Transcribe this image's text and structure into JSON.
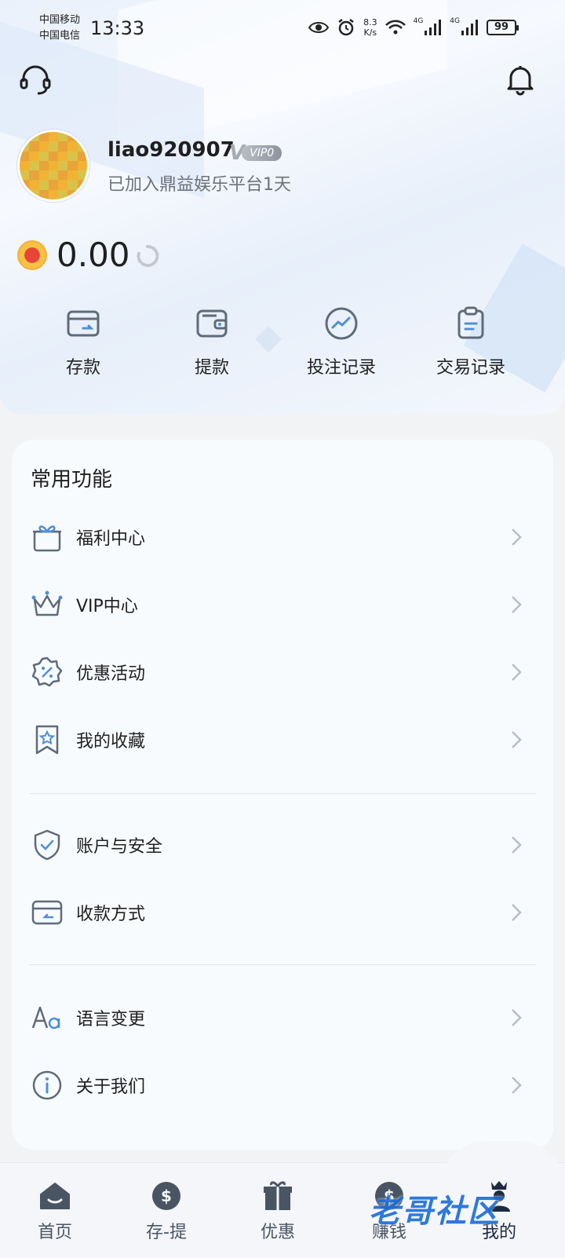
{
  "status_bar": {
    "carrier1": "中国移动",
    "carrier2": "中国电信",
    "time": "13:33",
    "net_speed_value": "8.3",
    "net_speed_unit": "K/s",
    "battery": "99",
    "net1": "4G",
    "net2": "4G"
  },
  "header": {
    "support_icon": "headset-icon",
    "bell_icon": "bell-icon"
  },
  "profile": {
    "username": "liao920907",
    "vip_v": "V",
    "vip_level": "VIP0",
    "joined_text": "已加入鼎益娱乐平台1天",
    "balance": "0.00"
  },
  "quick_actions": [
    {
      "label": "存款",
      "icon": "deposit-card-icon"
    },
    {
      "label": "提款",
      "icon": "wallet-icon"
    },
    {
      "label": "投注记录",
      "icon": "trend-icon"
    },
    {
      "label": "交易记录",
      "icon": "clipboard-icon"
    }
  ],
  "common_functions": {
    "title": "常用功能",
    "items": [
      {
        "label": "福利中心",
        "icon": "gift-icon"
      },
      {
        "label": "VIP中心",
        "icon": "crown-icon"
      },
      {
        "label": "优惠活动",
        "icon": "discount-badge-icon"
      },
      {
        "label": "我的收藏",
        "icon": "bookmark-star-icon"
      },
      {
        "label": "账户与安全",
        "icon": "shield-check-icon"
      },
      {
        "label": "收款方式",
        "icon": "card-icon"
      },
      {
        "label": "语言变更",
        "icon": "font-size-icon"
      },
      {
        "label": "关于我们",
        "icon": "info-icon"
      }
    ]
  },
  "bottom_nav": [
    {
      "label": "首页",
      "icon": "home-icon"
    },
    {
      "label": "存-提",
      "icon": "exchange-icon"
    },
    {
      "label": "优惠",
      "icon": "gift-box-icon"
    },
    {
      "label": "赚钱",
      "icon": "money-icon"
    },
    {
      "label": "我的",
      "icon": "profile-crown-icon"
    }
  ],
  "watermark": "老哥社区",
  "colors": {
    "accent_blue": "#4f8fd8",
    "icon_gray": "#5f6b7a",
    "coin_red": "#e8443a",
    "coin_gold": "#f6c243"
  }
}
